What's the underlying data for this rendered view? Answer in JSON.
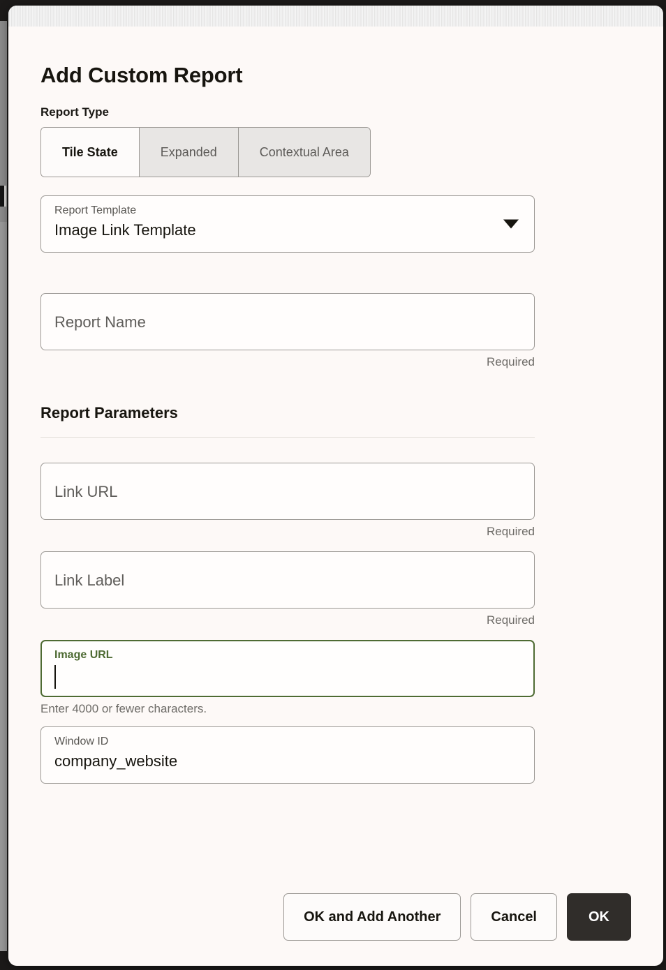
{
  "dialog": {
    "title": "Add Custom Report",
    "report_type": {
      "label": "Report Type",
      "options": [
        {
          "label": "Tile State",
          "selected": true
        },
        {
          "label": "Expanded",
          "selected": false
        },
        {
          "label": "Contextual Area",
          "selected": false
        }
      ]
    },
    "report_template": {
      "label": "Report Template",
      "value": "Image Link Template",
      "icon": "chevron-down-icon"
    },
    "report_name": {
      "placeholder": "Report Name",
      "value": "",
      "helper": "Required"
    },
    "parameters_section": {
      "title": "Report Parameters",
      "fields": [
        {
          "name": "link-url",
          "placeholder": "Link URL",
          "value": "",
          "helper": "Required",
          "helper_align": "right",
          "focused": false
        },
        {
          "name": "link-label",
          "placeholder": "Link Label",
          "value": "",
          "helper": "Required",
          "helper_align": "right",
          "focused": false
        },
        {
          "name": "image-url",
          "label": "Image URL",
          "value": "",
          "helper": "Enter 4000 or fewer characters.",
          "helper_align": "left",
          "focused": true
        },
        {
          "name": "window-id",
          "label": "Window ID",
          "value": "company_website",
          "helper": "",
          "helper_align": "left",
          "focused": false
        }
      ]
    },
    "footer": {
      "ok_and_add_another_label": "OK and Add Another",
      "cancel_label": "Cancel",
      "ok_label": "OK"
    }
  },
  "colors": {
    "dialog_background": "#fdf9f7",
    "page_backdrop": "#1c1a19",
    "focus_green": "#4e6b33",
    "primary_button": "#302d2a",
    "segment_unselected": "#e8e6e4",
    "border": "#9b9894",
    "helper_text": "#6d6b67"
  }
}
